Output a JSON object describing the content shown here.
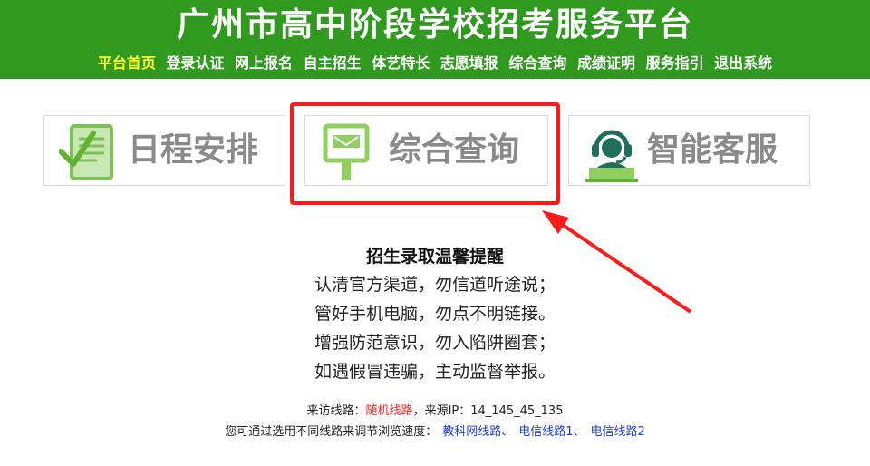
{
  "header": {
    "title": "广州市高中阶段学校招考服务平台",
    "nav": [
      {
        "label": "平台首页",
        "active": true
      },
      {
        "label": "登录认证",
        "active": false
      },
      {
        "label": "网上报名",
        "active": false
      },
      {
        "label": "自主招生",
        "active": false
      },
      {
        "label": "体艺特长",
        "active": false
      },
      {
        "label": "志愿填报",
        "active": false
      },
      {
        "label": "综合查询",
        "active": false
      },
      {
        "label": "成绩证明",
        "active": false
      },
      {
        "label": "服务指引",
        "active": false
      },
      {
        "label": "退出系统",
        "active": false
      }
    ]
  },
  "tiles": [
    {
      "label": "日程安排",
      "icon": "calendar-checklist-icon"
    },
    {
      "label": "综合查询",
      "icon": "mailbox-icon"
    },
    {
      "label": "智能客服",
      "icon": "support-agent-icon"
    }
  ],
  "annotation": {
    "highlight_color": "#ff1a1a",
    "target": "综合查询"
  },
  "notice": {
    "title": "招生录取温馨提醒",
    "lines": [
      "认清官方渠道，勿信道听途说；",
      "管好手机电脑，勿点不明链接。",
      "增强防范意识，勿入陷阱圈套；",
      "如遇假冒违骗，主动监督举报。"
    ]
  },
  "route": {
    "prefix": "来访线路：",
    "current": "随机线路",
    "source_label": "，来源IP：",
    "ip": "14_145_45_135"
  },
  "switch": {
    "prefix": "您可通过选用不同线路来调节浏览速度：",
    "links": [
      "教科网线路、",
      "电信线路1、",
      "电信线路2"
    ]
  },
  "colors": {
    "header_bg": "#2f9a1e",
    "nav_active": "#ffff33",
    "link": "#1d3bd8",
    "alert": "#ff2222"
  }
}
